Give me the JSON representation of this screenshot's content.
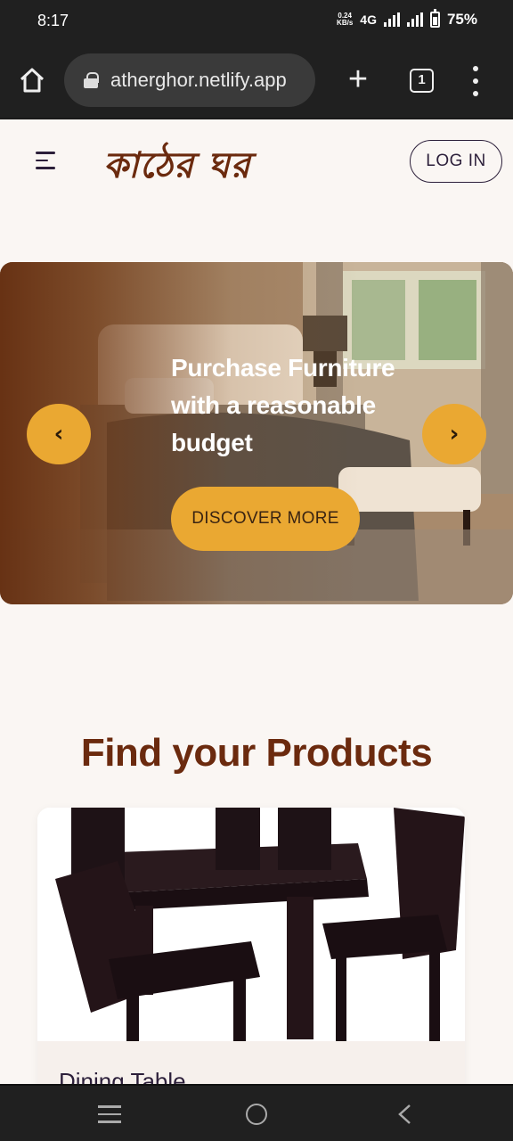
{
  "status_bar": {
    "time": "8:17",
    "net_speed_value": "0.24",
    "net_speed_unit": "KB/s",
    "network_type": "4G",
    "battery": "75%"
  },
  "browser": {
    "url": "atherghor.netlify.app",
    "tab_count": "1"
  },
  "header": {
    "logo_text": "কাঠের ঘর",
    "login_label": "LOG IN"
  },
  "hero": {
    "title": "Purchase Furniture with a reasonable budget",
    "cta_label": "DISCOVER MORE",
    "prev_label": "‹",
    "next_label": "›"
  },
  "products": {
    "section_title": "Find your Products",
    "items": [
      {
        "name": "Dining Table"
      }
    ]
  },
  "colors": {
    "brand_brown": "#6b2a0e",
    "accent_gold": "#eaa832",
    "dark_text": "#2c1f3a",
    "page_bg": "#faf6f3"
  }
}
